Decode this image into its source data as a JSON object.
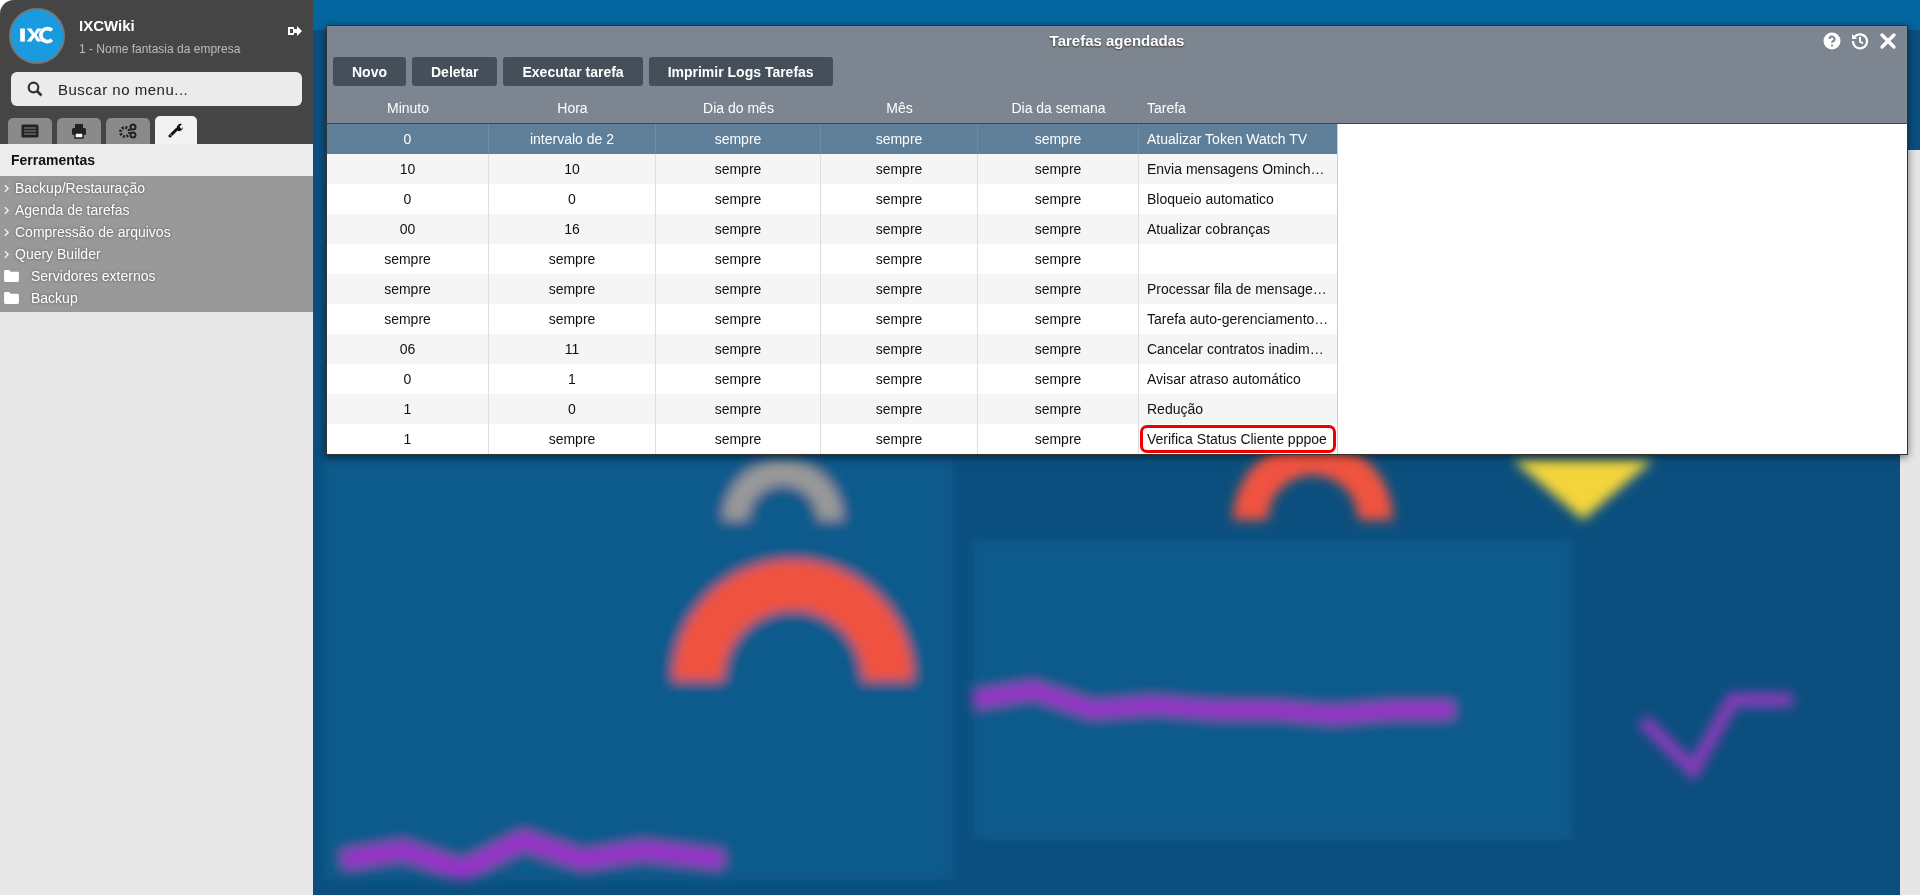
{
  "sidebar": {
    "app_name": "IXCWiki",
    "company": "1 - Nome fantasia da empresa",
    "search": {
      "placeholder": "Buscar no menu..."
    },
    "tabs": [
      {
        "kind": "list",
        "selected": false
      },
      {
        "kind": "print",
        "selected": false
      },
      {
        "kind": "gears",
        "selected": false
      },
      {
        "kind": "wrench",
        "selected": true
      }
    ],
    "section_title": "Ferramentas",
    "items": [
      {
        "kind": "group",
        "label": "Backup/Restauração"
      },
      {
        "kind": "group",
        "label": "Agenda de tarefas"
      },
      {
        "kind": "group",
        "label": "Compressão de arquivos"
      },
      {
        "kind": "group",
        "label": "Query Builder"
      },
      {
        "kind": "folder",
        "label": "Servidores externos"
      },
      {
        "kind": "folder",
        "label": "Backup"
      }
    ]
  },
  "dialog": {
    "title": "Tarefas agendadas",
    "buttons": [
      "Novo",
      "Deletar",
      "Executar tarefa",
      "Imprimir Logs Tarefas"
    ],
    "columns": [
      "Minuto",
      "Hora",
      "Dia do mês",
      "Mês",
      "Dia da semana",
      "Tarefa"
    ],
    "rows": [
      {
        "selected": true,
        "highlighted": false,
        "cells": [
          "0",
          "intervalo de 2",
          "sempre",
          "sempre",
          "sempre",
          "Atualizar Token Watch TV"
        ]
      },
      {
        "selected": false,
        "highlighted": false,
        "cells": [
          "10",
          "10",
          "sempre",
          "sempre",
          "sempre",
          "Envia mensagens Ominch…"
        ]
      },
      {
        "selected": false,
        "highlighted": false,
        "cells": [
          "0",
          "0",
          "sempre",
          "sempre",
          "sempre",
          "Bloqueio automatico"
        ]
      },
      {
        "selected": false,
        "highlighted": false,
        "cells": [
          "00",
          "16",
          "sempre",
          "sempre",
          "sempre",
          "Atualizar cobranças"
        ]
      },
      {
        "selected": false,
        "highlighted": false,
        "cells": [
          "sempre",
          "sempre",
          "sempre",
          "sempre",
          "sempre"
        ]
      },
      {
        "selected": false,
        "highlighted": false,
        "cells": [
          "sempre",
          "sempre",
          "sempre",
          "sempre",
          "sempre",
          "Processar fila de mensage…"
        ]
      },
      {
        "selected": false,
        "highlighted": false,
        "cells": [
          "sempre",
          "sempre",
          "sempre",
          "sempre",
          "sempre",
          "Tarefa auto-gerenciamento…"
        ]
      },
      {
        "selected": false,
        "highlighted": false,
        "cells": [
          "06",
          "11",
          "sempre",
          "sempre",
          "sempre",
          "Cancelar contratos inadim…"
        ]
      },
      {
        "selected": false,
        "highlighted": false,
        "cells": [
          "0",
          "1",
          "sempre",
          "sempre",
          "sempre",
          "Avisar atraso automático"
        ]
      },
      {
        "selected": false,
        "highlighted": false,
        "cells": [
          "1",
          "0",
          "sempre",
          "sempre",
          "sempre",
          "Redução"
        ]
      },
      {
        "selected": false,
        "highlighted": true,
        "cells": [
          "1",
          "sempre",
          "sempre",
          "sempre",
          "sempre",
          "Verifica Status Cliente pppoe"
        ]
      }
    ]
  }
}
